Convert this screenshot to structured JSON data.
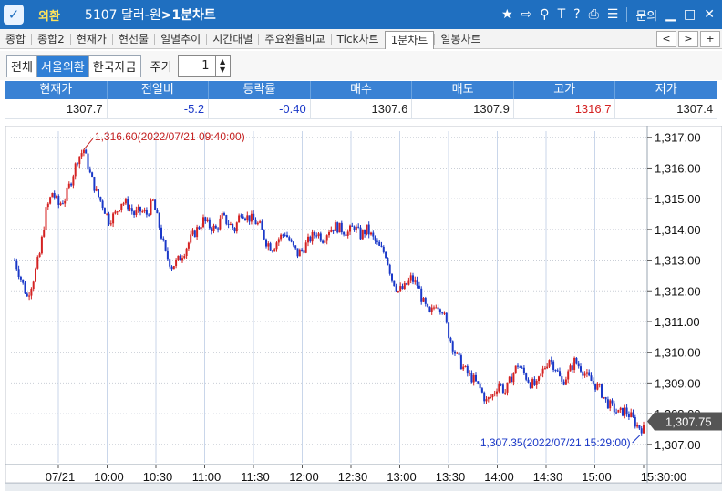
{
  "titlebar": {
    "menu_name": "외환",
    "window_title_prefix": "5107 달러-원",
    "window_title_suffix": ">1분차트",
    "inquiry": "문의",
    "icons": [
      "star-icon",
      "popout-icon",
      "link-icon",
      "text-icon",
      "help-icon",
      "print-icon",
      "list-icon",
      "minimize-icon",
      "maximize-icon",
      "close-icon"
    ]
  },
  "tabs": [
    {
      "label": "종합",
      "active": false
    },
    {
      "label": "종합2",
      "active": false
    },
    {
      "label": "현재가",
      "active": false
    },
    {
      "label": "현선물",
      "active": false
    },
    {
      "label": "일별추이",
      "active": false
    },
    {
      "label": "시간대별",
      "active": false
    },
    {
      "label": "주요환율비교",
      "active": false
    },
    {
      "label": "Tick차트",
      "active": false
    },
    {
      "label": "1분차트",
      "active": true
    },
    {
      "label": "일봉차트",
      "active": false
    }
  ],
  "tab_nav": {
    "prev": "<",
    "next": ">",
    "add": "+"
  },
  "filters": {
    "segments": [
      {
        "label": "전체",
        "active": false
      },
      {
        "label": "서울외환",
        "active": true
      },
      {
        "label": "한국자금",
        "active": false
      }
    ],
    "period_label": "주기",
    "period_value": "1"
  },
  "quote": {
    "headers": [
      "현재가",
      "전일비",
      "등락률",
      "매수",
      "매도",
      "고가",
      "저가"
    ],
    "values": [
      {
        "text": "1307.7",
        "tone": "normal"
      },
      {
        "text": "-5.2",
        "tone": "down"
      },
      {
        "text": "-0.40",
        "tone": "down"
      },
      {
        "text": "1307.6",
        "tone": "normal"
      },
      {
        "text": "1307.9",
        "tone": "normal"
      },
      {
        "text": "1316.7",
        "tone": "up"
      },
      {
        "text": "1307.4",
        "tone": "normal"
      }
    ]
  },
  "chart_data": {
    "type": "candlestick",
    "up_color": "#d42222",
    "down_color": "#1a38c8",
    "ylim": [
      1306.4,
      1317.2
    ],
    "y_ticks": [
      "1,317.00",
      "1,316.00",
      "1,315.00",
      "1,314.00",
      "1,313.00",
      "1,312.00",
      "1,311.00",
      "1,310.00",
      "1,309.00",
      "1,308.00",
      "1,307.00"
    ],
    "x_ticks": [
      "07/21",
      "10:00",
      "10:30",
      "11:00",
      "11:30",
      "12:00",
      "12:30",
      "13:00",
      "13:30",
      "14:00",
      "14:30",
      "15:00",
      "15:30:00"
    ],
    "current_price_label": "1,307.75",
    "high_annotation": "1,316.60(2022/07/21 09:40:00)",
    "low_annotation": "1,307.35(2022/07/21 15:29:00)",
    "price_path": [
      [
        0,
        1313.0
      ],
      [
        3,
        1312.4
      ],
      [
        6,
        1311.8
      ],
      [
        9,
        1312.4
      ],
      [
        12,
        1313.2
      ],
      [
        15,
        1314.6
      ],
      [
        18,
        1315.2
      ],
      [
        21,
        1314.8
      ],
      [
        24,
        1315.0
      ],
      [
        27,
        1315.6
      ],
      [
        30,
        1316.3
      ],
      [
        33,
        1316.6
      ],
      [
        36,
        1315.8
      ],
      [
        39,
        1315.2
      ],
      [
        42,
        1314.8
      ],
      [
        45,
        1314.3
      ],
      [
        48,
        1314.5
      ],
      [
        51,
        1314.9
      ],
      [
        54,
        1314.8
      ],
      [
        57,
        1314.5
      ],
      [
        60,
        1314.6
      ],
      [
        63,
        1314.5
      ],
      [
        66,
        1314.9
      ],
      [
        69,
        1314.1
      ],
      [
        72,
        1313.2
      ],
      [
        75,
        1312.8
      ],
      [
        78,
        1313.0
      ],
      [
        81,
        1313.3
      ],
      [
        84,
        1313.7
      ],
      [
        87,
        1314.0
      ],
      [
        90,
        1314.3
      ],
      [
        93,
        1314.1
      ],
      [
        96,
        1314.0
      ],
      [
        99,
        1314.4
      ],
      [
        102,
        1314.2
      ],
      [
        105,
        1314.0
      ],
      [
        108,
        1314.6
      ],
      [
        111,
        1314.4
      ],
      [
        114,
        1314.3
      ],
      [
        117,
        1314.1
      ],
      [
        120,
        1313.6
      ],
      [
        123,
        1313.4
      ],
      [
        126,
        1313.7
      ],
      [
        129,
        1313.9
      ],
      [
        132,
        1313.5
      ],
      [
        135,
        1313.2
      ],
      [
        138,
        1313.4
      ],
      [
        141,
        1313.7
      ],
      [
        144,
        1313.9
      ],
      [
        147,
        1313.7
      ],
      [
        150,
        1314.0
      ],
      [
        153,
        1314.1
      ],
      [
        156,
        1314.0
      ],
      [
        159,
        1313.9
      ],
      [
        162,
        1314.1
      ],
      [
        165,
        1313.8
      ],
      [
        168,
        1314.0
      ],
      [
        171,
        1313.7
      ],
      [
        174,
        1313.4
      ],
      [
        177,
        1313.2
      ],
      [
        180,
        1312.4
      ],
      [
        183,
        1312.0
      ],
      [
        186,
        1312.1
      ],
      [
        189,
        1312.4
      ],
      [
        192,
        1312.2
      ],
      [
        195,
        1311.6
      ],
      [
        198,
        1311.2
      ],
      [
        201,
        1311.6
      ],
      [
        204,
        1311.4
      ],
      [
        207,
        1310.6
      ],
      [
        210,
        1310.0
      ],
      [
        213,
        1309.6
      ],
      [
        216,
        1309.3
      ],
      [
        219,
        1309.1
      ],
      [
        222,
        1308.8
      ],
      [
        225,
        1308.4
      ],
      [
        228,
        1308.6
      ],
      [
        231,
        1309.0
      ],
      [
        234,
        1308.7
      ],
      [
        237,
        1309.2
      ],
      [
        240,
        1309.6
      ],
      [
        243,
        1309.3
      ],
      [
        246,
        1309.0
      ],
      [
        249,
        1308.9
      ],
      [
        252,
        1309.4
      ],
      [
        255,
        1309.8
      ],
      [
        258,
        1309.5
      ],
      [
        261,
        1309.0
      ],
      [
        264,
        1309.3
      ],
      [
        267,
        1309.7
      ],
      [
        270,
        1309.5
      ],
      [
        273,
        1309.2
      ],
      [
        276,
        1309.0
      ],
      [
        279,
        1308.8
      ],
      [
        282,
        1308.4
      ],
      [
        285,
        1308.2
      ],
      [
        288,
        1308.0
      ],
      [
        291,
        1308.1
      ],
      [
        294,
        1307.9
      ],
      [
        297,
        1307.6
      ],
      [
        300,
        1307.5
      ]
    ]
  }
}
